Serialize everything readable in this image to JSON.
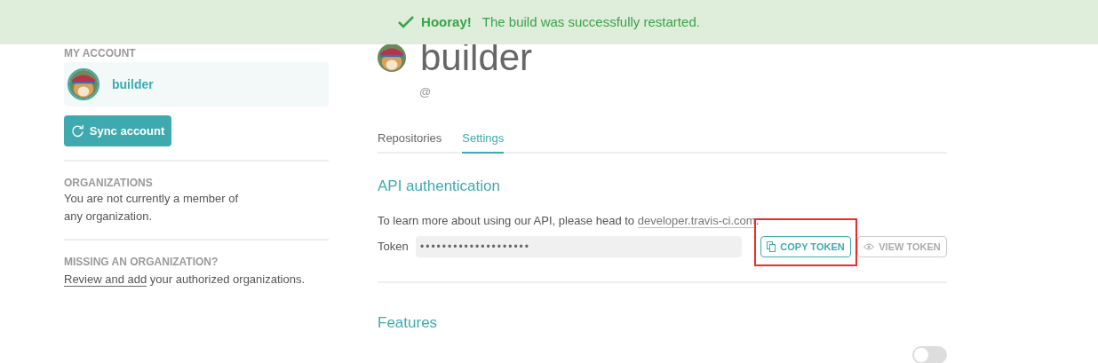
{
  "banner": {
    "title": "Hooray!",
    "message": "The build was successfully restarted."
  },
  "sidebar": {
    "account_heading": "MY ACCOUNT",
    "account": {
      "name": "builder",
      "selected": true
    },
    "sync_button": "Sync account",
    "sections": [
      {
        "heading": "ORGANIZATIONS",
        "lines": [
          "You are not currently a member of",
          "any organization."
        ]
      },
      {
        "heading": "MISSING AN ORGANIZATION?",
        "link": "Review and add",
        "text": " your authorized organizations."
      }
    ]
  },
  "profile": {
    "name": "builder",
    "handle": "@"
  },
  "tabs": [
    {
      "label": "Repositories",
      "selected": false
    },
    {
      "label": "Settings",
      "selected": true
    }
  ],
  "api": {
    "heading": "API authentication",
    "intro": "To learn more about using our API, please head to ",
    "link": "developer.travis-ci.com",
    "intro_end": ".",
    "token_label": "Token",
    "token_value": "••••••••••••••••••••",
    "copy_button": "COPY TOKEN",
    "view_button": "VIEW TOKEN",
    "copy_highlighted": true
  },
  "features": {
    "heading": "Features",
    "toggle": {
      "on": false
    }
  }
}
